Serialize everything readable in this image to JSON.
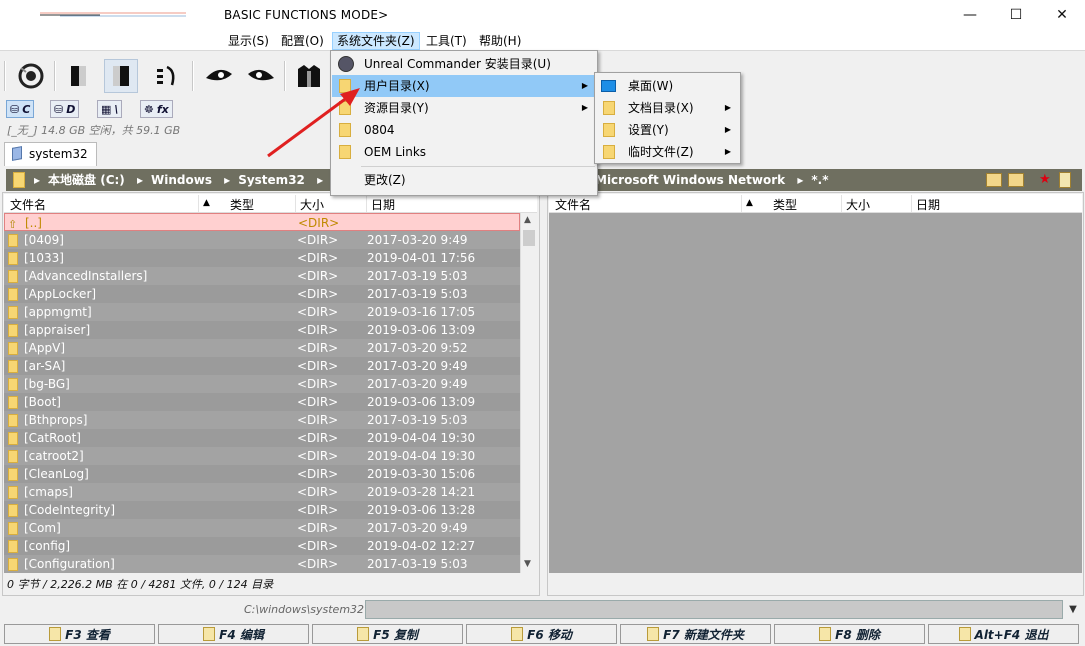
{
  "window": {
    "title": "BASIC FUNCTIONS MODE>",
    "minimize_glyph": "—",
    "maximize_glyph": "☐",
    "close_glyph": "✕"
  },
  "menubar": {
    "items": [
      {
        "label": "显示(S)"
      },
      {
        "label": "配置(O)"
      },
      {
        "label": "系统文件夹(Z)"
      },
      {
        "label": "工具(T)"
      },
      {
        "label": "帮助(H)"
      }
    ]
  },
  "toolbar": {
    "icons": [
      "eye-icon",
      "panel-left-icon",
      "panel-right-icon",
      "settings-list-icon",
      "eye-left-icon",
      "eye-right-icon",
      "viewer-icon"
    ]
  },
  "drives": {
    "items": [
      {
        "label": "C",
        "icon": "hard-drive-icon"
      },
      {
        "label": "D",
        "icon": "disk-icon"
      },
      {
        "label": "\\",
        "icon": "network-icon"
      },
      {
        "label": "fx",
        "icon": "wheel-icon"
      }
    ],
    "info": "[_无_] 14.8 GB 空闲，共 59.1 GB"
  },
  "left_panel": {
    "tab": "system32",
    "path": [
      "本地磁盘 (C:)",
      "Windows",
      "System32",
      "*.*"
    ],
    "columns": [
      "文件名",
      "类型",
      "大小",
      "日期"
    ],
    "rows": [
      {
        "name": "[..]",
        "type": "<DIR>",
        "date": ""
      },
      {
        "name": "[0409]",
        "type": "<DIR>",
        "date": "2017-03-20 9:49"
      },
      {
        "name": "[1033]",
        "type": "<DIR>",
        "date": "2019-04-01 17:56"
      },
      {
        "name": "[AdvancedInstallers]",
        "type": "<DIR>",
        "date": "2017-03-19 5:03"
      },
      {
        "name": "[AppLocker]",
        "type": "<DIR>",
        "date": "2017-03-19 5:03"
      },
      {
        "name": "[appmgmt]",
        "type": "<DIR>",
        "date": "2019-03-16 17:05"
      },
      {
        "name": "[appraiser]",
        "type": "<DIR>",
        "date": "2019-03-06 13:09"
      },
      {
        "name": "[AppV]",
        "type": "<DIR>",
        "date": "2017-03-20 9:52"
      },
      {
        "name": "[ar-SA]",
        "type": "<DIR>",
        "date": "2017-03-20 9:49"
      },
      {
        "name": "[bg-BG]",
        "type": "<DIR>",
        "date": "2017-03-20 9:49"
      },
      {
        "name": "[Boot]",
        "type": "<DIR>",
        "date": "2019-03-06 13:09"
      },
      {
        "name": "[Bthprops]",
        "type": "<DIR>",
        "date": "2017-03-19 5:03"
      },
      {
        "name": "[CatRoot]",
        "type": "<DIR>",
        "date": "2019-04-04 19:30"
      },
      {
        "name": "[catroot2]",
        "type": "<DIR>",
        "date": "2019-04-04 19:30"
      },
      {
        "name": "[CleanLog]",
        "type": "<DIR>",
        "date": "2019-03-30 15:06"
      },
      {
        "name": "[cmaps]",
        "type": "<DIR>",
        "date": "2019-03-28 14:21"
      },
      {
        "name": "[CodeIntegrity]",
        "type": "<DIR>",
        "date": "2019-03-06 13:28"
      },
      {
        "name": "[Com]",
        "type": "<DIR>",
        "date": "2017-03-20 9:49"
      },
      {
        "name": "[config]",
        "type": "<DIR>",
        "date": "2019-04-02 12:27"
      },
      {
        "name": "[Configuration]",
        "type": "<DIR>",
        "date": "2017-03-19 5:03"
      }
    ],
    "status": "0 字节 / 2,226.2 MB 在 0 / 4281 文件, 0 / 124 目录"
  },
  "right_panel": {
    "path": [
      "Microsoft Windows Network",
      "*.*"
    ],
    "columns": [
      "文件名",
      "类型",
      "大小",
      "日期"
    ]
  },
  "command_line": {
    "prompt": "C:\\windows\\system32\\>",
    "value": ""
  },
  "function_keys": [
    {
      "label": "F3 查看"
    },
    {
      "label": "F4 编辑"
    },
    {
      "label": "F5 复制"
    },
    {
      "label": "F6 移动"
    },
    {
      "label": "F7 新建文件夹"
    },
    {
      "label": "F8 删除"
    },
    {
      "label": "Alt+F4 退出"
    }
  ],
  "system_folder_menu": {
    "items": [
      {
        "label": "Unreal Commander 安装目录(U)"
      },
      {
        "label": "用户目录(X)"
      },
      {
        "label": "资源目录(Y)"
      },
      {
        "label": "0804"
      },
      {
        "label": "OEM Links"
      },
      {
        "label": "更改(Z)"
      }
    ]
  },
  "user_dir_submenu": {
    "items": [
      {
        "label": "桌面(W)"
      },
      {
        "label": "文档目录(X)"
      },
      {
        "label": "设置(Y)"
      },
      {
        "label": "临时文件(Z)"
      }
    ]
  },
  "colors": {
    "accent_red_arrow": "#e02020",
    "path_bar": "#6f6f60",
    "list_bg": "#a3a3a3",
    "menu_highlight": "#91c9f7"
  }
}
